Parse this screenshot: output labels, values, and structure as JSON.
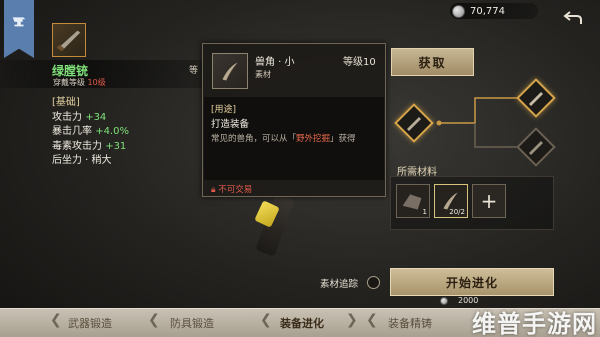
{
  "currency": {
    "amount": "70,774",
    "icon": "silver-coin-icon"
  },
  "weapon": {
    "name": "绿膛铳",
    "equip_prefix": "穿戴等级",
    "equip_level": "10级",
    "tail_label": "等",
    "stats_header": "[基础]",
    "stats": [
      {
        "label": "攻击力",
        "value": "+34"
      },
      {
        "label": "暴击几率",
        "value": "+4.0%"
      },
      {
        "label": "毒素攻击力",
        "value": "+31"
      },
      {
        "label": "后坐力 · 稍大",
        "value": ""
      }
    ]
  },
  "tooltip": {
    "name": "兽角 · 小",
    "level": "等级10",
    "type": "素材",
    "use_header": "[用途]",
    "use_text": "打造装备",
    "desc_before": "常见的兽角，可以从「",
    "desc_highlight": "野外挖掘",
    "desc_after": "」获得",
    "lock_text": "不可交易"
  },
  "buttons": {
    "acquire": "获取",
    "start_evolve": "开始进化"
  },
  "materials": {
    "label": "所需材料",
    "slots": [
      {
        "count": "1",
        "icon": "cloth-material-icon"
      },
      {
        "count": "20/2",
        "icon": "horn-material-icon"
      }
    ],
    "add_symbol": "+"
  },
  "track_label": "素材追踪",
  "cost": {
    "amount": "2000"
  },
  "tabs": [
    {
      "label": "武器锻造",
      "active": false
    },
    {
      "label": "防具锻造",
      "active": false
    },
    {
      "label": "装备进化",
      "active": true
    },
    {
      "label": "装备精铸",
      "active": false
    }
  ],
  "watermark": "维普手游网",
  "colors": {
    "accent_gold": "#d8a64a",
    "stat_green": "#7fe07a",
    "warn_red": "#e25a4a"
  }
}
